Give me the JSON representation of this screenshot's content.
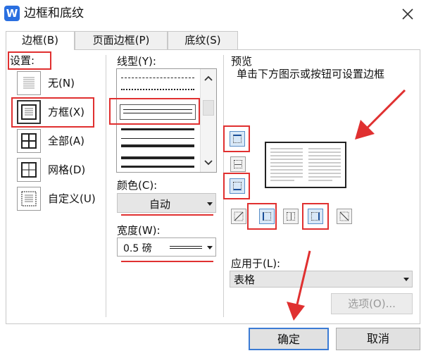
{
  "window": {
    "title": "边框和底纹",
    "app_icon": "W"
  },
  "tabs": [
    {
      "label": "边框(B)",
      "active": true
    },
    {
      "label": "页面边框(P)",
      "active": false
    },
    {
      "label": "底纹(S)",
      "active": false
    }
  ],
  "settings": {
    "label": "设置:",
    "options": [
      {
        "label": "无(N)",
        "icon": "none-border-icon",
        "selected": false
      },
      {
        "label": "方框(X)",
        "icon": "box-border-icon",
        "selected": true
      },
      {
        "label": "全部(A)",
        "icon": "all-borders-icon",
        "selected": false
      },
      {
        "label": "网格(D)",
        "icon": "grid-border-icon",
        "selected": false
      },
      {
        "label": "自定义(U)",
        "icon": "custom-border-icon",
        "selected": false
      }
    ]
  },
  "line_style": {
    "label": "线型(Y):",
    "selected_index": 2
  },
  "color": {
    "label": "颜色(C):",
    "value": "自动"
  },
  "width": {
    "label": "宽度(W):",
    "value": "0.5 磅"
  },
  "preview": {
    "label": "预览",
    "hint": "单击下方图示或按钮可设置边框"
  },
  "apply_to": {
    "label": "应用于(L):",
    "value": "表格"
  },
  "buttons": {
    "options": "选项(O)...",
    "ok": "确定",
    "cancel": "取消"
  },
  "colors": {
    "accent": "#3b7bd4",
    "annotation": "#e03030",
    "selected_fill": "#d8e8f7"
  }
}
